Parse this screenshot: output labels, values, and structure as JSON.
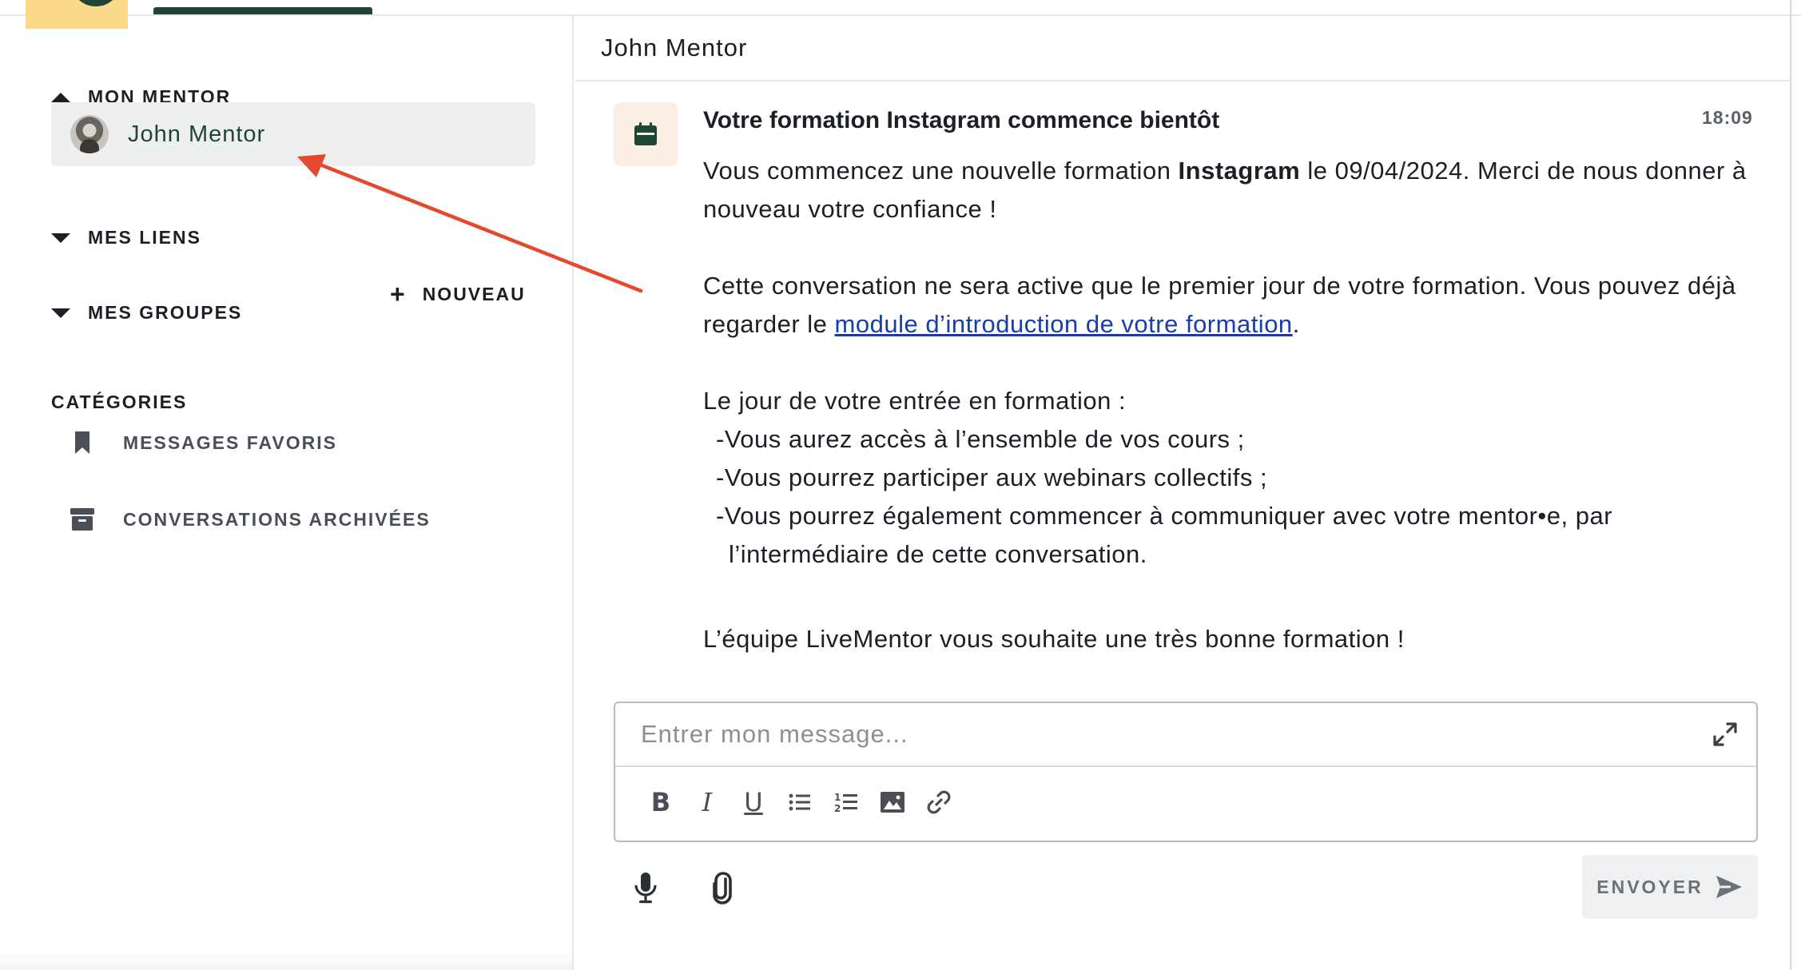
{
  "sidebar": {
    "mentor_section": {
      "title": "MON MENTOR",
      "items": [
        {
          "name": "John Mentor"
        }
      ]
    },
    "links_section": {
      "title": "MES LIENS"
    },
    "groups_section": {
      "title": "MES GROUPES",
      "new_label": "NOUVEAU"
    },
    "categories": {
      "title": "CATÉGORIES",
      "items": [
        {
          "label": "MESSAGES FAVORIS",
          "icon": "bookmark-icon"
        },
        {
          "label": "CONVERSATIONS ARCHIVÉES",
          "icon": "archive-box-icon"
        }
      ]
    }
  },
  "chat": {
    "title": "John Mentor",
    "message": {
      "icon": "calendar-icon",
      "title": "Votre formation Instagram commence bientôt",
      "time": "18:09",
      "p1_before": "Vous commencez une nouvelle formation ",
      "p1_bold": "Instagram",
      "p1_after": " le 09/04/2024. Merci de nous donner à nouveau votre confiance !",
      "p2_before": "Cette conversation ne sera active que le premier jour de votre formation. Vous pouvez déjà regarder le ",
      "p2_link": "module d’introduction de votre formation",
      "p2_after": ".",
      "p3_intro": "Le jour de votre entrée en formation :",
      "bullets": [
        "-Vous aurez accès à l’ensemble de vos cours ;",
        "-Vous pourrez participer aux webinars collectifs ;",
        "-Vous pourrez également commencer à communiquer avec votre mentor•e, par"
      ],
      "bullet_continuation": "l’intermédiaire de cette conversation.",
      "signature": "L’équipe LiveMentor vous souhaite une très bonne formation !"
    }
  },
  "composer": {
    "placeholder": "Entrer mon message...",
    "toolbar": [
      {
        "icon": "bold-icon",
        "glyph": "B"
      },
      {
        "icon": "italic-icon",
        "glyph": "I"
      },
      {
        "icon": "underline-icon",
        "glyph": "U"
      },
      {
        "icon": "bullet-list-icon"
      },
      {
        "icon": "numbered-list-icon"
      },
      {
        "icon": "image-icon"
      },
      {
        "icon": "link-icon"
      }
    ],
    "send_label": "ENVOYER"
  },
  "colors": {
    "brand_green": "#1f4634",
    "logo_yellow": "#fbd98c",
    "annotation_red": "#e5472f",
    "link_blue": "#1a3ea8"
  }
}
